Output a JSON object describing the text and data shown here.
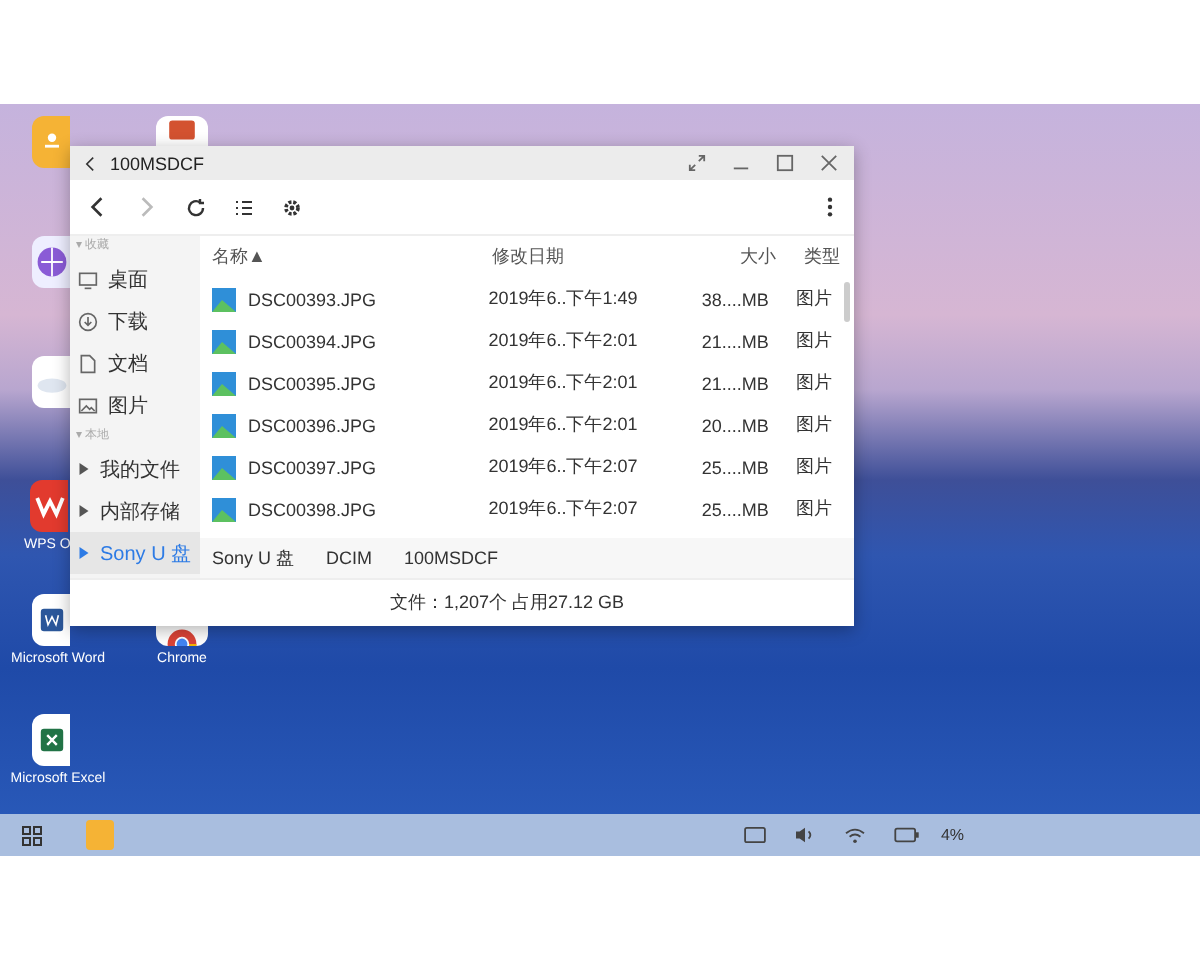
{
  "desktop": {
    "icons": [
      {
        "kind": "notes"
      },
      {
        "kind": "slides"
      },
      {
        "kind": "browser"
      },
      {
        "kind": "cloud"
      },
      {
        "kind": "wps",
        "label": "WPS O"
      },
      {
        "kind": "word",
        "label": "Microsoft Word"
      },
      {
        "kind": "chrome",
        "label": "Chrome"
      },
      {
        "kind": "excel",
        "label": "Microsoft Excel"
      }
    ]
  },
  "window": {
    "title": "100MSDCF",
    "toolbar": {
      "back_disabled": false,
      "forward_disabled": true
    },
    "sidebar": [
      {
        "title": "▾ 收藏",
        "items": [
          {
            "label": "桌面",
            "kind": "desktop",
            "selected": false
          },
          {
            "label": "下载",
            "kind": "download",
            "selected": false
          },
          {
            "label": "文档",
            "kind": "document",
            "selected": false
          },
          {
            "label": "图片",
            "kind": "picture",
            "selected": false
          }
        ]
      },
      {
        "title": "▾ 本地",
        "items": [
          {
            "label": "我的文件",
            "kind": "tree",
            "selected": false
          },
          {
            "label": "内部存储",
            "kind": "tree",
            "selected": false
          },
          {
            "label": "Sony U 盘",
            "kind": "tree",
            "selected": true
          }
        ]
      }
    ],
    "table": {
      "columns": [
        {
          "label": "名称",
          "sort_mark": "▲"
        },
        {
          "label": "修改日期"
        },
        {
          "label": "大小"
        },
        {
          "label": "类型"
        }
      ],
      "rows": [
        {
          "name": "DSC00393.JPG",
          "date": "2019年6..下午1:49",
          "size": "38....MB",
          "type": "图片"
        },
        {
          "name": "DSC00394.JPG",
          "date": "2019年6..下午2:01",
          "size": "21....MB",
          "type": "图片"
        },
        {
          "name": "DSC00395.JPG",
          "date": "2019年6..下午2:01",
          "size": "21....MB",
          "type": "图片"
        },
        {
          "name": "DSC00396.JPG",
          "date": "2019年6..下午2:01",
          "size": "20....MB",
          "type": "图片"
        },
        {
          "name": "DSC00397.JPG",
          "date": "2019年6..下午2:07",
          "size": "25....MB",
          "type": "图片"
        },
        {
          "name": "DSC00398.JPG",
          "date": "2019年6..下午2:07",
          "size": "25....MB",
          "type": "图片"
        }
      ]
    },
    "breadcrumb": [
      "Sony U 盘",
      "DCIM",
      "100MSDCF"
    ],
    "status": "文件：1,207个 占用27.12 GB"
  },
  "taskbar": {
    "battery": "4%"
  }
}
